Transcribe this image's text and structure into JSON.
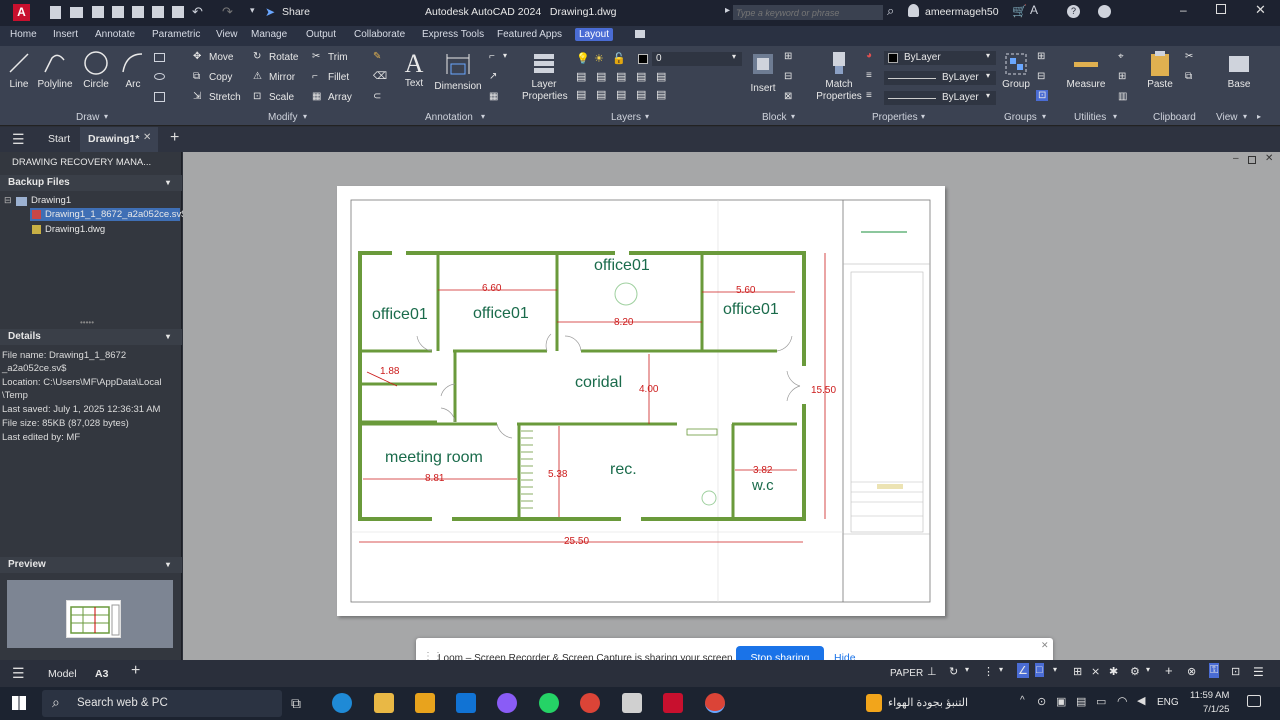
{
  "titlebar": {
    "app_icon": "A",
    "share_label": "Share",
    "title": "Autodesk AutoCAD 2024   Drawing1.dwg",
    "search_placeholder": "Type a keyword or phrase",
    "username": "ameermageh50"
  },
  "ribbon_tabs": [
    "Home",
    "Insert",
    "Annotate",
    "Parametric",
    "View",
    "Manage",
    "Output",
    "Collaborate",
    "Express Tools",
    "Featured Apps",
    "Layout"
  ],
  "ribbon": {
    "draw": {
      "line": "Line",
      "polyline": "Polyline",
      "circle": "Circle",
      "arc": "Arc",
      "label": "Draw"
    },
    "modify": {
      "move": "Move",
      "rotate": "Rotate",
      "trim": "Trim",
      "copy": "Copy",
      "mirror": "Mirror",
      "fillet": "Fillet",
      "stretch": "Stretch",
      "scale": "Scale",
      "array": "Array",
      "label": "Modify"
    },
    "annotation": {
      "text": "Text",
      "dimension": "Dimension",
      "label": "Annotation"
    },
    "layers": {
      "layer_properties": "Layer\nProperties",
      "current_layer": "0",
      "label": "Layers"
    },
    "block": {
      "insert": "Insert",
      "label": "Block"
    },
    "properties": {
      "match": "Match\nProperties",
      "bylayer1": "ByLayer",
      "bylayer2": "ByLayer",
      "bylayer3": "ByLayer",
      "label": "Properties"
    },
    "groups": {
      "group": "Group",
      "label": "Groups"
    },
    "utilities": {
      "measure": "Measure",
      "label": "Utilities"
    },
    "clipboard": {
      "paste": "Paste",
      "label": "Clipboard"
    },
    "view": {
      "base": "Base",
      "label": "View"
    }
  },
  "doc_tabs": {
    "start": "Start",
    "drawing": "Drawing1*"
  },
  "recovery": {
    "title": "DRAWING RECOVERY MANA...",
    "backup_header": "Backup Files",
    "tree_root": "Drawing1",
    "tree_item1": "Drawing1_1_8672_a2a052ce.sv$",
    "tree_item2": "Drawing1.dwg",
    "details_header": "Details",
    "details": [
      "File name: Drawing1_1_8672",
      "_a2a052ce.sv$",
      "Location: C:\\Users\\MF\\AppData\\Local",
      "\\Temp",
      "Last saved: July 1, 2025  12:36:31 AM",
      "File size: 85KB (87,028 bytes)",
      "Last edited by: MF"
    ],
    "preview_header": "Preview"
  },
  "floorplan": {
    "rooms": {
      "office_a": "office01",
      "office_b": "office01",
      "office_c": "office01",
      "office_d": "office01",
      "coridal": "coridal",
      "meeting": "meeting room",
      "rec": "rec.",
      "wc": "w.c"
    },
    "dims": {
      "d660": "6.60",
      "d560": "5.60",
      "d820": "8.20",
      "d188": "1.88",
      "d400": "4.00",
      "d1550": "15.50",
      "d538": "5.38",
      "d881": "8.81",
      "d382": "3.82",
      "d2550": "25.50"
    }
  },
  "loom": {
    "message": "Loom – Screen Recorder & Screen Capture is sharing your screen.",
    "stop": "Stop sharing",
    "hide": "Hide"
  },
  "status": {
    "model": "Model",
    "layout": "A3",
    "paper": "PAPER"
  },
  "taskbar": {
    "search": "Search web & PC",
    "weather": "التنبؤ بجودة الهواء",
    "lang": "ENG",
    "time": "11:59 AM",
    "date": "7/1/25"
  },
  "colors": {
    "accent": "#4a6cd4",
    "wall": "#6a9a3b",
    "dim": "#cc1b1b",
    "room_text": "#1a6b4b"
  }
}
